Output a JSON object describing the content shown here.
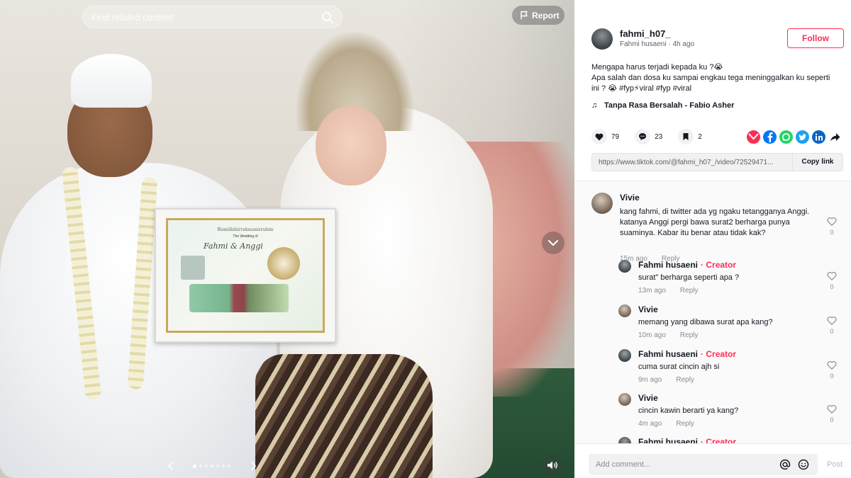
{
  "search": {
    "placeholder": "Find related content"
  },
  "report": {
    "label": "Report"
  },
  "certificate": {
    "heading": "Bismillahirrahmanirrahim",
    "subtitle": "The Wedding of",
    "names": "Fahmi & Anggi"
  },
  "carousel": {
    "total": 7,
    "active_index": 0
  },
  "author": {
    "username": "fahmi_h07_",
    "display_name": "Fahmi husaeni",
    "posted": "4h ago",
    "follow_label": "Follow"
  },
  "caption": {
    "line1": "Mengapa harus terjadi kepada ku ?😭",
    "line2": "Apa salah dan dosa ku sampai engkau tega meninggalkan ku seperti ini ? 😭 #fyp⚡viral #fyp #viral"
  },
  "music": {
    "title": "Tanpa Rasa Bersalah - Fabio Asher"
  },
  "stats": {
    "likes": "79",
    "comments": "23",
    "saves": "2"
  },
  "share_icons": [
    {
      "name": "embed-icon",
      "color": "#fe2c55"
    },
    {
      "name": "facebook-icon",
      "color": "#0075fa"
    },
    {
      "name": "whatsapp-icon",
      "color": "#25d366"
    },
    {
      "name": "twitter-icon",
      "color": "#1da1f2"
    },
    {
      "name": "linkedin-icon",
      "color": "#0a66c2"
    },
    {
      "name": "share-arrow-icon",
      "color": "#161823"
    }
  ],
  "link": {
    "url": "https://www.tiktok.com/@fahmi_h07_/video/72529471...",
    "copy_label": "Copy link"
  },
  "comments": [
    {
      "name": "Vivie",
      "badge": "",
      "text": "kang fahmi, di twitter ada yg ngaku tetangganya Anggi. katanya Anggi pergi bawa surat2 berharga punya suaminya. Kabar itu benar atau tidak kak?",
      "time": "15m ago",
      "reply": "Reply",
      "likes": "0"
    },
    {
      "name": "Fahmi husaeni",
      "badge": "· Creator",
      "text": "surat\" berharga seperti apa ?",
      "time": "13m ago",
      "reply": "Reply",
      "likes": "0"
    },
    {
      "name": "Vivie",
      "badge": "",
      "text": "memang yang dibawa surat apa kang?",
      "time": "10m ago",
      "reply": "Reply",
      "likes": "0"
    },
    {
      "name": "Fahmi husaeni",
      "badge": "· Creator",
      "text": "cuma surat cincin ajh si",
      "time": "9m ago",
      "reply": "Reply",
      "likes": "0"
    },
    {
      "name": "Vivie",
      "badge": "",
      "text": "cincin kawin berarti ya kang?",
      "time": "4m ago",
      "reply": "Reply",
      "likes": "0"
    },
    {
      "name": "Fahmi husaeni",
      "badge": "· Creator",
      "text": "",
      "time": "",
      "reply": "",
      "likes": ""
    }
  ],
  "comment_box": {
    "placeholder": "Add comment...",
    "post_label": "Post"
  },
  "colors": {
    "accent": "#fe2c55",
    "text": "#161823",
    "muted": "#8a8b91"
  }
}
